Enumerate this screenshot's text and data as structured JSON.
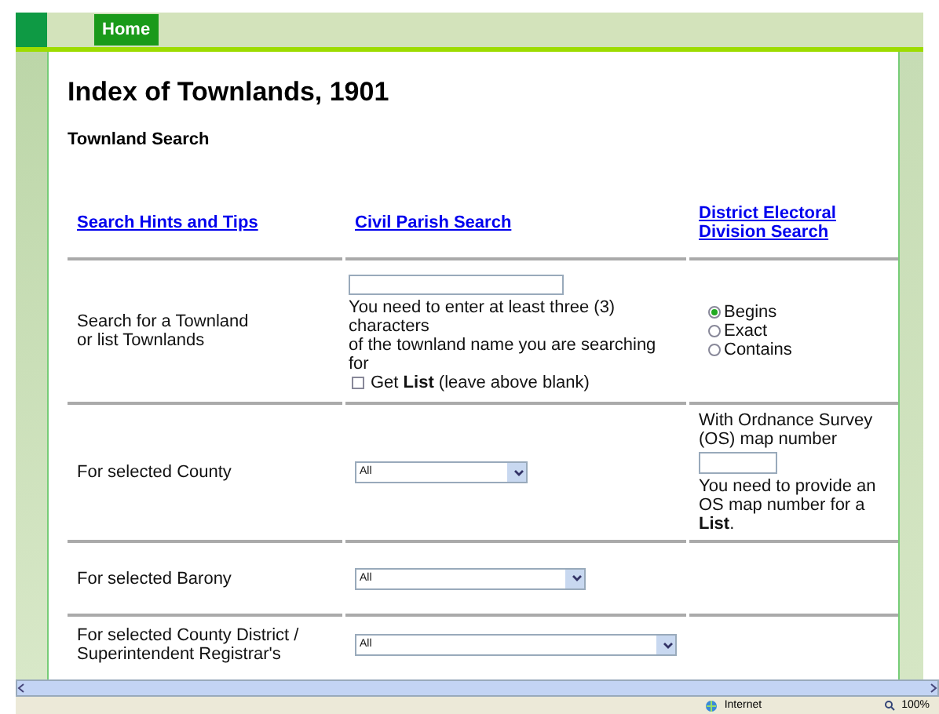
{
  "nav": [
    {
      "label": "Home",
      "selected": true
    }
  ],
  "title": "Index of Townlands, 1901",
  "subtitle": "Townland Search",
  "links": [
    "Search Hints and Tips",
    "Civil Parish Search",
    "District Electoral Division Search"
  ],
  "rows": [
    {
      "kind": "text-search",
      "label": [
        "Search for a Townland",
        "or list Townlands"
      ],
      "hint": [
        "You need to enter at least three (3)",
        "characters",
        "of the townland name you are searching",
        "for"
      ],
      "checkbox": {
        "label": "Get **List** (leave above blank)",
        "checked": false
      },
      "options": [
        {
          "label": "Begins",
          "selected": true
        },
        {
          "label": "Exact",
          "selected": false
        },
        {
          "label": "Contains",
          "selected": false
        }
      ]
    },
    {
      "kind": "select",
      "label": [
        "For selected County"
      ],
      "value": "All",
      "side": {
        "caption": [
          "With Ordnance Survey",
          "(OS) map number"
        ],
        "note": "You need to provide an OS map number for a **List**."
      }
    },
    {
      "kind": "select",
      "label": [
        "For selected Barony"
      ],
      "value": "All"
    },
    {
      "kind": "select",
      "label": [
        "For selected County District /",
        "Superintendent Registrar's"
      ],
      "value": "All"
    }
  ],
  "status_bar": {
    "zone": "Internet",
    "zoom": "100%"
  }
}
